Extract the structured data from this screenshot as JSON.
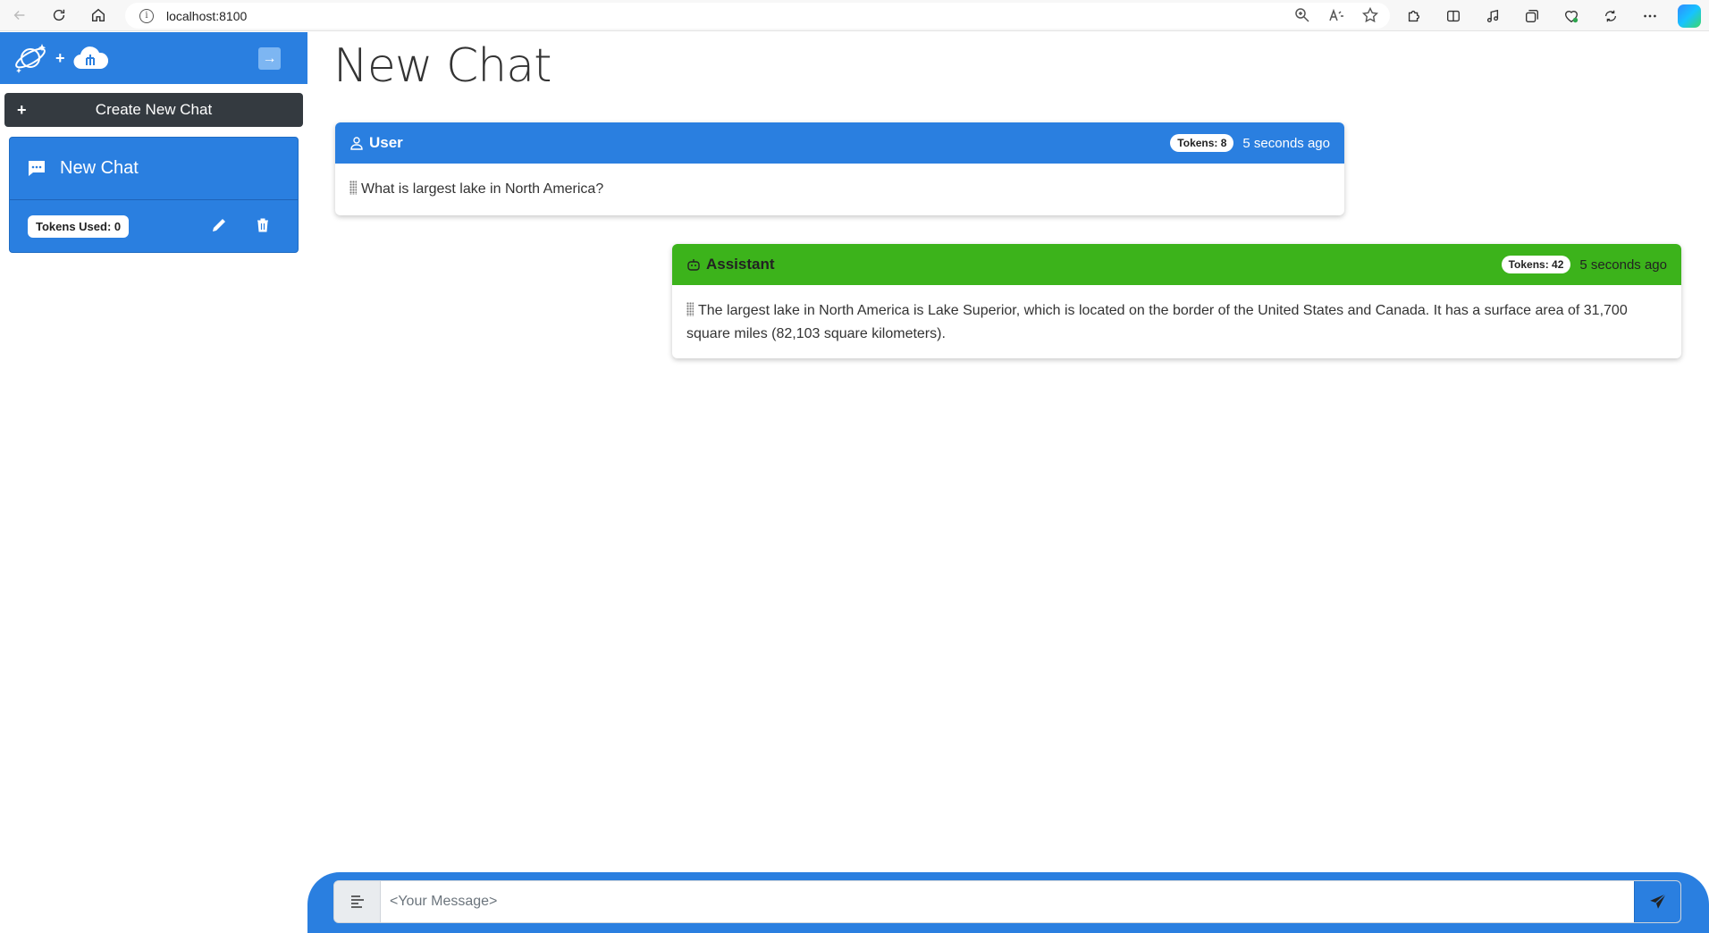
{
  "browser": {
    "url": "localhost:8100"
  },
  "sidebar": {
    "create_label": "Create New Chat",
    "create_plus": "+",
    "logo_plus": "+",
    "collapse_glyph": "→",
    "chats": [
      {
        "title": "New Chat",
        "tokens_label": "Tokens Used: 0"
      }
    ]
  },
  "main": {
    "title": "New Chat",
    "messages": [
      {
        "role": "User",
        "tokens": "Tokens: 8",
        "time": "5 seconds ago",
        "text": "What is largest lake in North America?",
        "header_color": "#2a7fe0"
      },
      {
        "role": "Assistant",
        "tokens": "Tokens: 42",
        "time": "5 seconds ago",
        "text": "The largest lake in North America is Lake Superior, which is located on the border of the United States and Canada. It has a surface area of 31,700 square miles (82,103 square kilometers).",
        "header_color": "#3cb31b"
      }
    ]
  },
  "composer": {
    "placeholder": "<Your Message>"
  },
  "colors": {
    "primary": "#2a7fe0",
    "assistant": "#3cb31b",
    "dark_button": "#343a40"
  }
}
